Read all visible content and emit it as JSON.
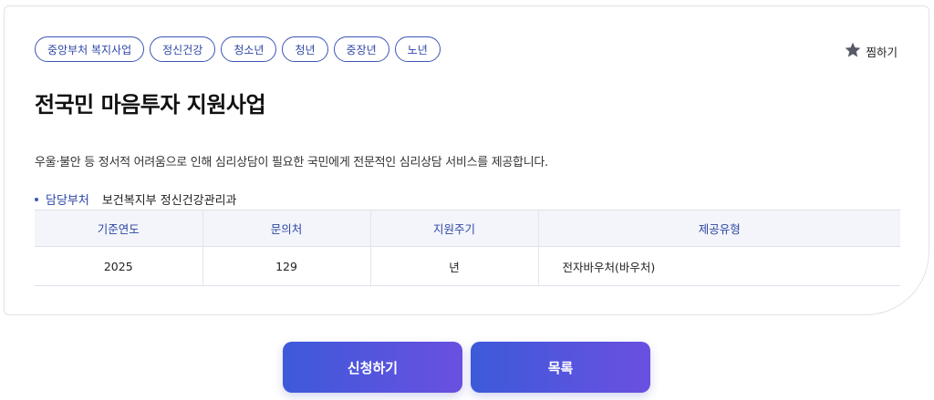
{
  "tags": [
    "중앙부처 복지사업",
    "정신건강",
    "청소년",
    "청년",
    "중장년",
    "노년"
  ],
  "favorite_label": "찜하기",
  "title": "전국민 마음투자 지원사업",
  "description": "우울·불안 등 정서적 어려움으로 인해 심리상담이 필요한 국민에게 전문적인 심리상담 서비스를 제공합니다.",
  "department": {
    "label": "담당부처",
    "value": "보건복지부 정신건강관리과"
  },
  "table": {
    "headers": [
      "기준연도",
      "문의처",
      "지원주기",
      "제공유형"
    ],
    "row": [
      "2025",
      "129",
      "년",
      "전자바우처(바우처)"
    ]
  },
  "buttons": {
    "apply": "신청하기",
    "list": "목록"
  },
  "colors": {
    "accent": "#2e46a5",
    "button_start": "#3d5ad9",
    "button_end": "#6a50e0",
    "star": "#555a66"
  }
}
